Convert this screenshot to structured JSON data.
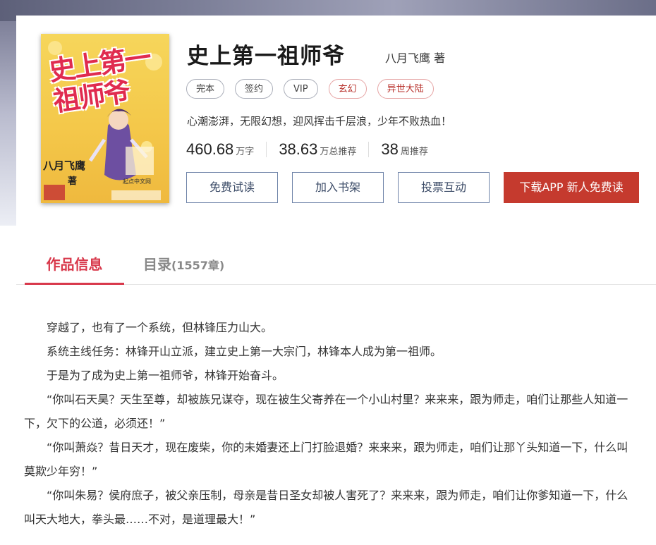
{
  "book": {
    "title": "史上第一祖师爷",
    "author": "八月飞鹰 著",
    "tags": [
      {
        "label": "完本",
        "style": "gray"
      },
      {
        "label": "签约",
        "style": "gray"
      },
      {
        "label": "VIP",
        "style": "gray"
      },
      {
        "label": "玄幻",
        "style": "red"
      },
      {
        "label": "异世大陆",
        "style": "red"
      }
    ],
    "intro": "心潮澎湃，无限幻想，迎风挥击千层浪，少年不败热血！",
    "stats": [
      {
        "value": "460.68",
        "unit": "万字"
      },
      {
        "value": "38.63",
        "unit": "万总推荐"
      },
      {
        "value": "38",
        "unit": "周推荐"
      }
    ]
  },
  "cover": {
    "title_art": "史上第一祖师爷",
    "author_art": "八月飞鹰",
    "zhu_art": "著",
    "note_art": "起点中文网"
  },
  "actions": {
    "free_read": "免费试读",
    "add_shelf": "加入书架",
    "vote": "投票互动",
    "download_app": "下载APP 新人免费读"
  },
  "tabs": {
    "info": "作品信息",
    "toc": "目录",
    "toc_count": "(1557章)"
  },
  "description": [
    "穿越了，也有了一个系统，但林锋压力山大。",
    "系统主线任务：林锋开山立派，建立史上第一大宗门，林锋本人成为第一祖师。",
    "于是为了成为史上第一祖师爷，林锋开始奋斗。",
    "“你叫石天昊？天生至尊，却被族兄谋夺，现在被生父寄养在一个小山村里？来来来，跟为师走，咱们让那些人知道一下，欠下的公道，必须还！”",
    "“你叫萧焱？昔日天才，现在废柴，你的未婚妻还上门打脸退婚？来来来，跟为师走，咱们让那丫头知道一下，什么叫莫欺少年穷！”",
    "“你叫朱易？侯府庶子，被父亲压制，母亲是昔日圣女却被人害死了？来来来，跟为师走，咱们让你爹知道一下，什么叫天大地大，拳头最……不对，是道理最大！”"
  ],
  "colors": {
    "accent_red": "#d8384b",
    "button_red": "#c53a2e",
    "button_border": "#6e83a8"
  }
}
